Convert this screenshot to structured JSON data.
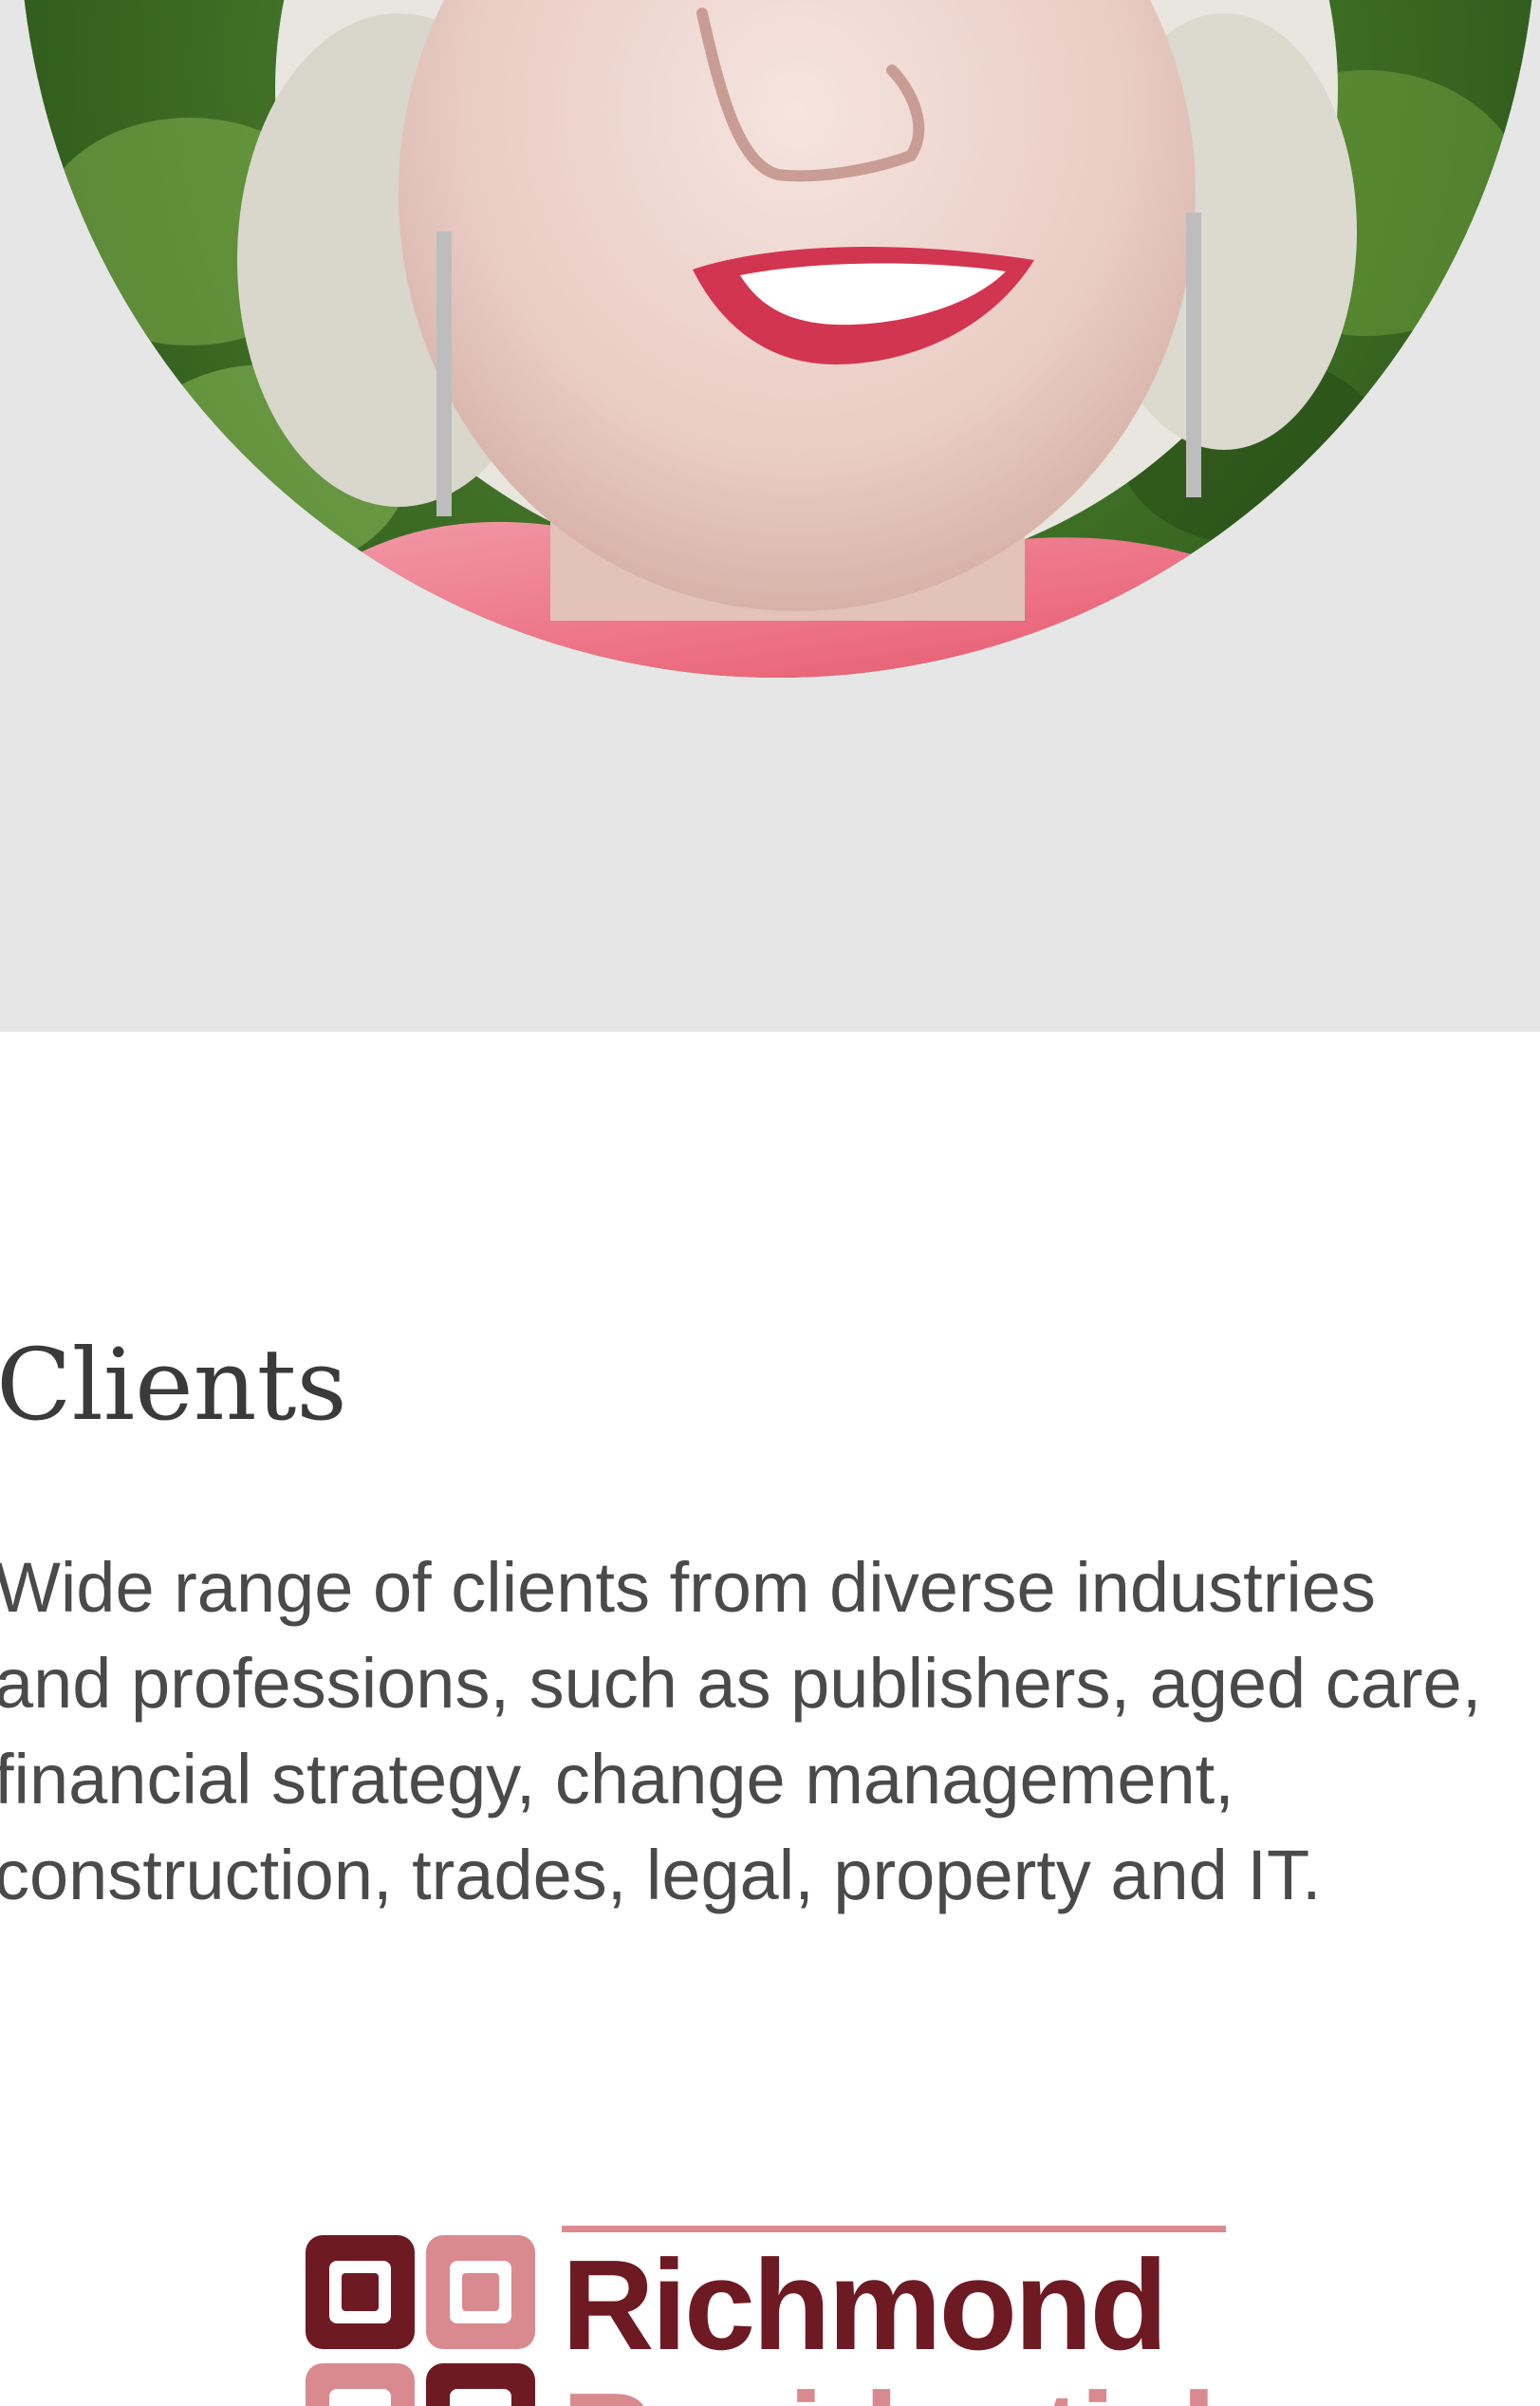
{
  "clients": {
    "title": "Clients",
    "description_lines": [
      "Wide range of clients from diverse industries",
      "and professions, such as publishers, aged care,",
      "financial strategy, change management,",
      "construction, trades, legal, property and IT."
    ]
  },
  "logo": {
    "line1": "Richmond",
    "line2": "Residential"
  },
  "colors": {
    "hero_background": "#e6e6e6",
    "heading_text": "#3a3a3a",
    "body_text": "#4a4a4a",
    "logo_dark": "#6e1a22",
    "logo_light": "#d98a8f"
  }
}
